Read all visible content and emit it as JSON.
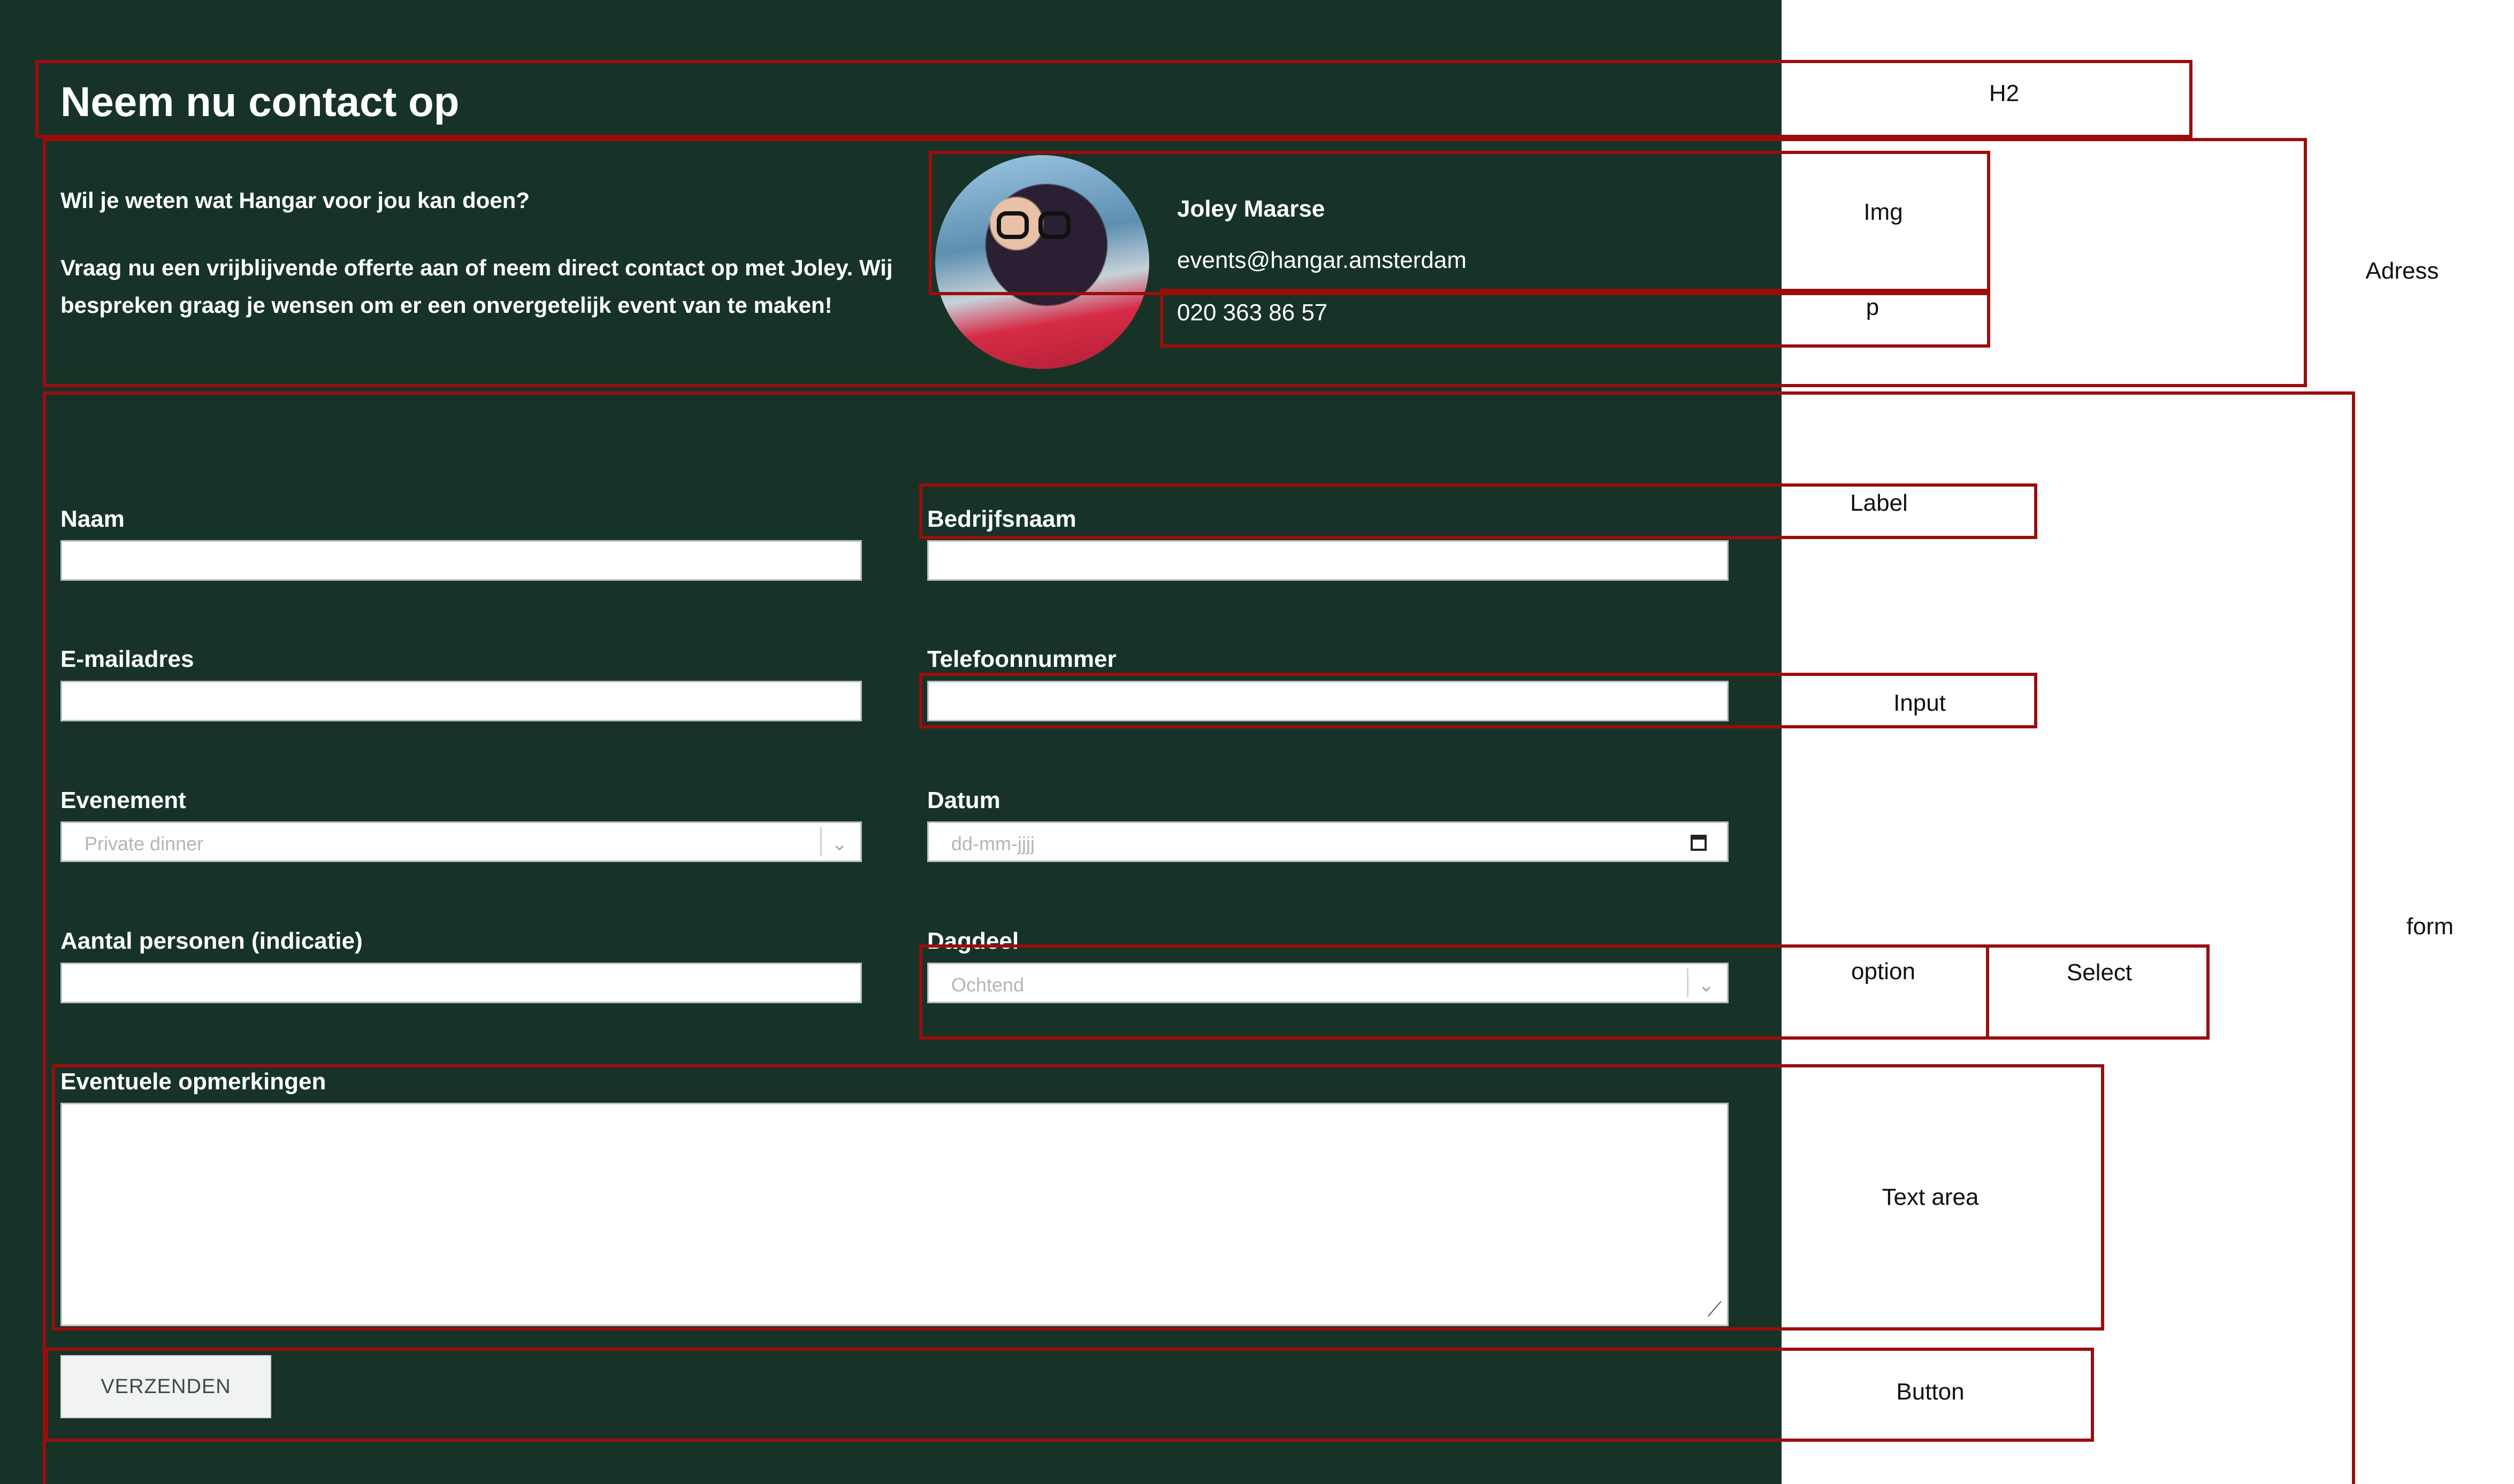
{
  "contact": {
    "heading": "Neem nu contact op",
    "intro_question": "Wil je weten wat Hangar voor jou kan doen?",
    "intro_text": "Vraag nu een vrijblijvende offerte aan of neem direct contact op met Joley. Wij bespreken graag je wensen om er een onvergetelijk event van te maken!",
    "person_name": "Joley Maarse",
    "email": "events@hangar.amsterdam",
    "phone": "020 363 86 57"
  },
  "form": {
    "naam_label": "Naam",
    "bedrijfsnaam_label": "Bedrijfsnaam",
    "email_label": "E-mailadres",
    "telefoon_label": "Telefoonnummer",
    "evenement_label": "Evenement",
    "evenement_value": "Private dinner",
    "datum_label": "Datum",
    "datum_placeholder": "dd-mm-jjjj",
    "personen_label": "Aantal personen (indicatie)",
    "dagdeel_label": "Dagdeel",
    "dagdeel_value": "Ochtend",
    "opmerkingen_label": "Eventuele opmerkingen",
    "submit_label": "VERZENDEN"
  },
  "annotations": {
    "h2": "H2",
    "img": "Img",
    "p": "p",
    "address": "Adress",
    "label": "Label",
    "input": "Input",
    "option": "option",
    "select": "Select",
    "textarea": "Text area",
    "button": "Button",
    "form": "form"
  }
}
